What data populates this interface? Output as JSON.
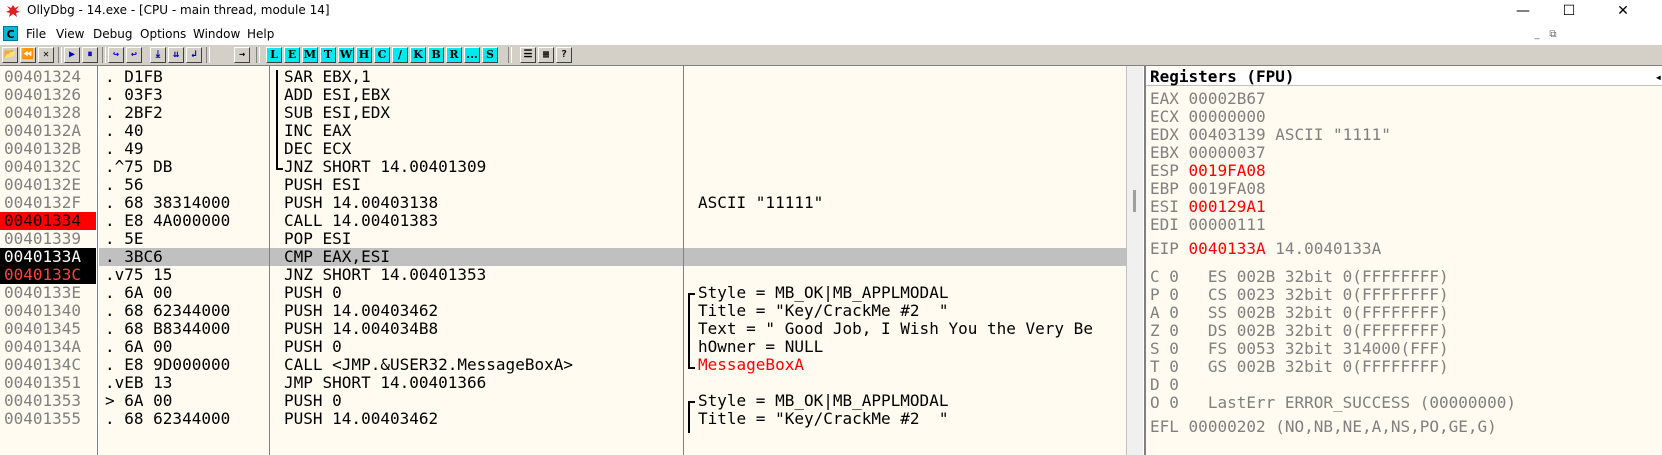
{
  "window": {
    "title": "OllyDbg - 14.exe - [CPU - main thread, module 14]",
    "minimize": "—",
    "maximize": "☐",
    "close": "✕"
  },
  "menu": {
    "mdi_icon": "C",
    "items": [
      "File",
      "View",
      "Debug",
      "Options",
      "Window",
      "Help"
    ],
    "mdi_minimize": "_",
    "mdi_restore": "⧉"
  },
  "toolbar": {
    "buttons": [
      "📂",
      "⏪",
      "✕",
      "▶",
      "⏸",
      "↪",
      "↩",
      "⤓",
      "⇊",
      "↲",
      "→"
    ],
    "letters": [
      "L",
      "E",
      "M",
      "T",
      "W",
      "H",
      "C",
      "/",
      "K",
      "B",
      "R",
      "...",
      "S"
    ],
    "tail": [
      "☰",
      "▦",
      "?"
    ]
  },
  "disasm": {
    "rows": [
      {
        "addr": "00401324",
        "addr_style": "normal",
        "hex": ". D1FB",
        "dis": "SAR EBX,1",
        "cmt": "",
        "cmt_style": "normal"
      },
      {
        "addr": "00401326",
        "addr_style": "normal",
        "hex": ". 03F3",
        "dis": "ADD ESI,EBX",
        "cmt": "",
        "cmt_style": "normal"
      },
      {
        "addr": "00401328",
        "addr_style": "normal",
        "hex": ". 2BF2",
        "dis": "SUB ESI,EDX",
        "cmt": "",
        "cmt_style": "normal"
      },
      {
        "addr": "0040132A",
        "addr_style": "normal",
        "hex": ". 40",
        "dis": "INC EAX",
        "cmt": "",
        "cmt_style": "normal"
      },
      {
        "addr": "0040132B",
        "addr_style": "normal",
        "hex": ". 49",
        "dis": "DEC ECX",
        "cmt": "",
        "cmt_style": "normal"
      },
      {
        "addr": "0040132C",
        "addr_style": "normal",
        "hex": ".^75 DB",
        "dis": "JNZ SHORT 14.00401309",
        "cmt": "",
        "cmt_style": "normal"
      },
      {
        "addr": "0040132E",
        "addr_style": "normal",
        "hex": ". 56",
        "dis": "PUSH ESI",
        "cmt": "",
        "cmt_style": "normal"
      },
      {
        "addr": "0040132F",
        "addr_style": "normal",
        "hex": ". 68 38314000",
        "dis": "PUSH 14.00403138",
        "cmt": "ASCII \"11111\"",
        "cmt_style": "normal"
      },
      {
        "addr": "00401334",
        "addr_style": "red",
        "hex": ". E8 4A000000",
        "dis": "CALL 14.00401383",
        "cmt": "",
        "cmt_style": "normal"
      },
      {
        "addr": "00401339",
        "addr_style": "normal",
        "hex": ". 5E",
        "dis": "POP ESI",
        "cmt": "",
        "cmt_style": "normal"
      },
      {
        "addr": "0040133A",
        "addr_style": "cur",
        "hex": ". 3BC6",
        "dis": "CMP EAX,ESI",
        "cmt": "",
        "cmt_style": "normal"
      },
      {
        "addr": "0040133C",
        "addr_style": "curred",
        "hex": ".v75 15",
        "dis": "JNZ SHORT 14.00401353",
        "cmt": "",
        "cmt_style": "normal"
      },
      {
        "addr": "0040133E",
        "addr_style": "normal",
        "hex": ". 6A 00",
        "dis": "PUSH 0",
        "cmt": "Style = MB_OK|MB_APPLMODAL",
        "cmt_style": "normal"
      },
      {
        "addr": "00401340",
        "addr_style": "normal",
        "hex": ". 68 62344000",
        "dis": "PUSH 14.00403462",
        "cmt": "Title = \"Key/CrackMe #2  \"",
        "cmt_style": "normal"
      },
      {
        "addr": "00401345",
        "addr_style": "normal",
        "hex": ". 68 B8344000",
        "dis": "PUSH 14.004034B8",
        "cmt": "Text = \" Good Job, I Wish You the Very Be",
        "cmt_style": "normal"
      },
      {
        "addr": "0040134A",
        "addr_style": "normal",
        "hex": ". 6A 00",
        "dis": "PUSH 0",
        "cmt": "hOwner = NULL",
        "cmt_style": "normal"
      },
      {
        "addr": "0040134C",
        "addr_style": "normal",
        "hex": ". E8 9D000000",
        "dis": "CALL <JMP.&USER32.MessageBoxA>",
        "cmt": "MessageBoxA",
        "cmt_style": "red"
      },
      {
        "addr": "00401351",
        "addr_style": "normal",
        "hex": ".vEB 13",
        "dis": "JMP SHORT 14.00401366",
        "cmt": "",
        "cmt_style": "normal"
      },
      {
        "addr": "00401353",
        "addr_style": "normal",
        "hex": "> 6A 00",
        "dis": "PUSH 0",
        "cmt": "Style = MB_OK|MB_APPLMODAL",
        "cmt_style": "normal"
      },
      {
        "addr": "00401355",
        "addr_style": "normal",
        "hex": ". 68 62344000",
        "dis": "PUSH 14.00403462",
        "cmt": "Title = \"Key/CrackMe #2  \"",
        "cmt_style": "normal"
      }
    ]
  },
  "registers": {
    "header": "Registers (FPU)",
    "arrow": "◂",
    "rows": [
      {
        "name": "EAX",
        "value": "00002B67",
        "value_style": "normal",
        "extra": ""
      },
      {
        "name": "ECX",
        "value": "00000000",
        "value_style": "normal",
        "extra": ""
      },
      {
        "name": "EDX",
        "value": "00403139",
        "value_style": "normal",
        "extra": "ASCII \"1111\""
      },
      {
        "name": "EBX",
        "value": "00000037",
        "value_style": "normal",
        "extra": ""
      },
      {
        "name": "ESP",
        "value": "0019FA08",
        "value_style": "red",
        "extra": ""
      },
      {
        "name": "EBP",
        "value": "0019FA08",
        "value_style": "normal",
        "extra": ""
      },
      {
        "name": "ESI",
        "value": "000129A1",
        "value_style": "red",
        "extra": ""
      },
      {
        "name": "EDI",
        "value": "00000111",
        "value_style": "normal",
        "extra": ""
      },
      {
        "name": "EIP",
        "value": "0040133A",
        "value_style": "red",
        "extra": "14.0040133A"
      },
      {
        "name": "C 0",
        "value": "",
        "value_style": "normal",
        "extra": "ES 002B 32bit 0(FFFFFFFF)"
      },
      {
        "name": "P 0",
        "value": "",
        "value_style": "normal",
        "extra": "CS 0023 32bit 0(FFFFFFFF)"
      },
      {
        "name": "A 0",
        "value": "",
        "value_style": "normal",
        "extra": "SS 002B 32bit 0(FFFFFFFF)"
      },
      {
        "name": "Z 0",
        "value": "",
        "value_style": "normal",
        "extra": "DS 002B 32bit 0(FFFFFFFF)"
      },
      {
        "name": "S 0",
        "value": "",
        "value_style": "normal",
        "extra": "FS 0053 32bit 314000(FFF)"
      },
      {
        "name": "T 0",
        "value": "",
        "value_style": "normal",
        "extra": "GS 002B 32bit 0(FFFFFFFF)"
      },
      {
        "name": "D 0",
        "value": "",
        "value_style": "normal",
        "extra": ""
      },
      {
        "name": "O 0",
        "value": "",
        "value_style": "normal",
        "extra": "LastErr ERROR_SUCCESS (00000000)"
      },
      {
        "name": "EFL",
        "value": "00000202",
        "value_style": "normal",
        "extra": "(NO,NB,NE,A,NS,PO,GE,G)"
      }
    ]
  }
}
